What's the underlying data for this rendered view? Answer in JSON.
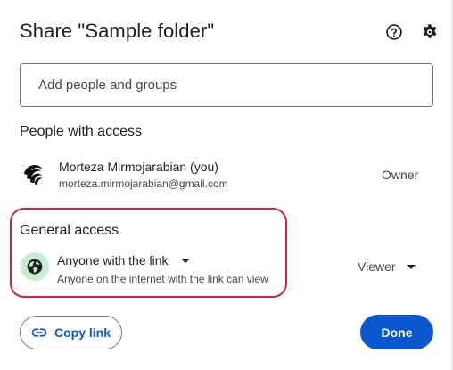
{
  "dialog": {
    "title": "Share \"Sample folder\"",
    "help_icon": "help-circle-icon",
    "settings_icon": "gear-icon"
  },
  "add_people": {
    "placeholder": "Add people and groups",
    "value": ""
  },
  "people_section": {
    "title": "People with access",
    "people": [
      {
        "name": "Morteza Mirmojarabian (you)",
        "email": "morteza.mirmojarabian@gmail.com",
        "role": "Owner",
        "avatar_icon": "swirl-logo-avatar"
      }
    ]
  },
  "general_access": {
    "title": "General access",
    "icon": "globe-icon",
    "link_setting": "Anyone with the link",
    "description": "Anyone on the internet with the link can view",
    "role": "Viewer"
  },
  "footer": {
    "copy_link_label": "Copy link",
    "copy_link_icon": "link-icon",
    "done_label": "Done"
  },
  "colors": {
    "primary": "#0b57d0",
    "highlight_border": "#d0253a",
    "globe_badge_bg": "#c4eed0",
    "text": "#1f1f1f",
    "secondary_text": "#444746"
  }
}
